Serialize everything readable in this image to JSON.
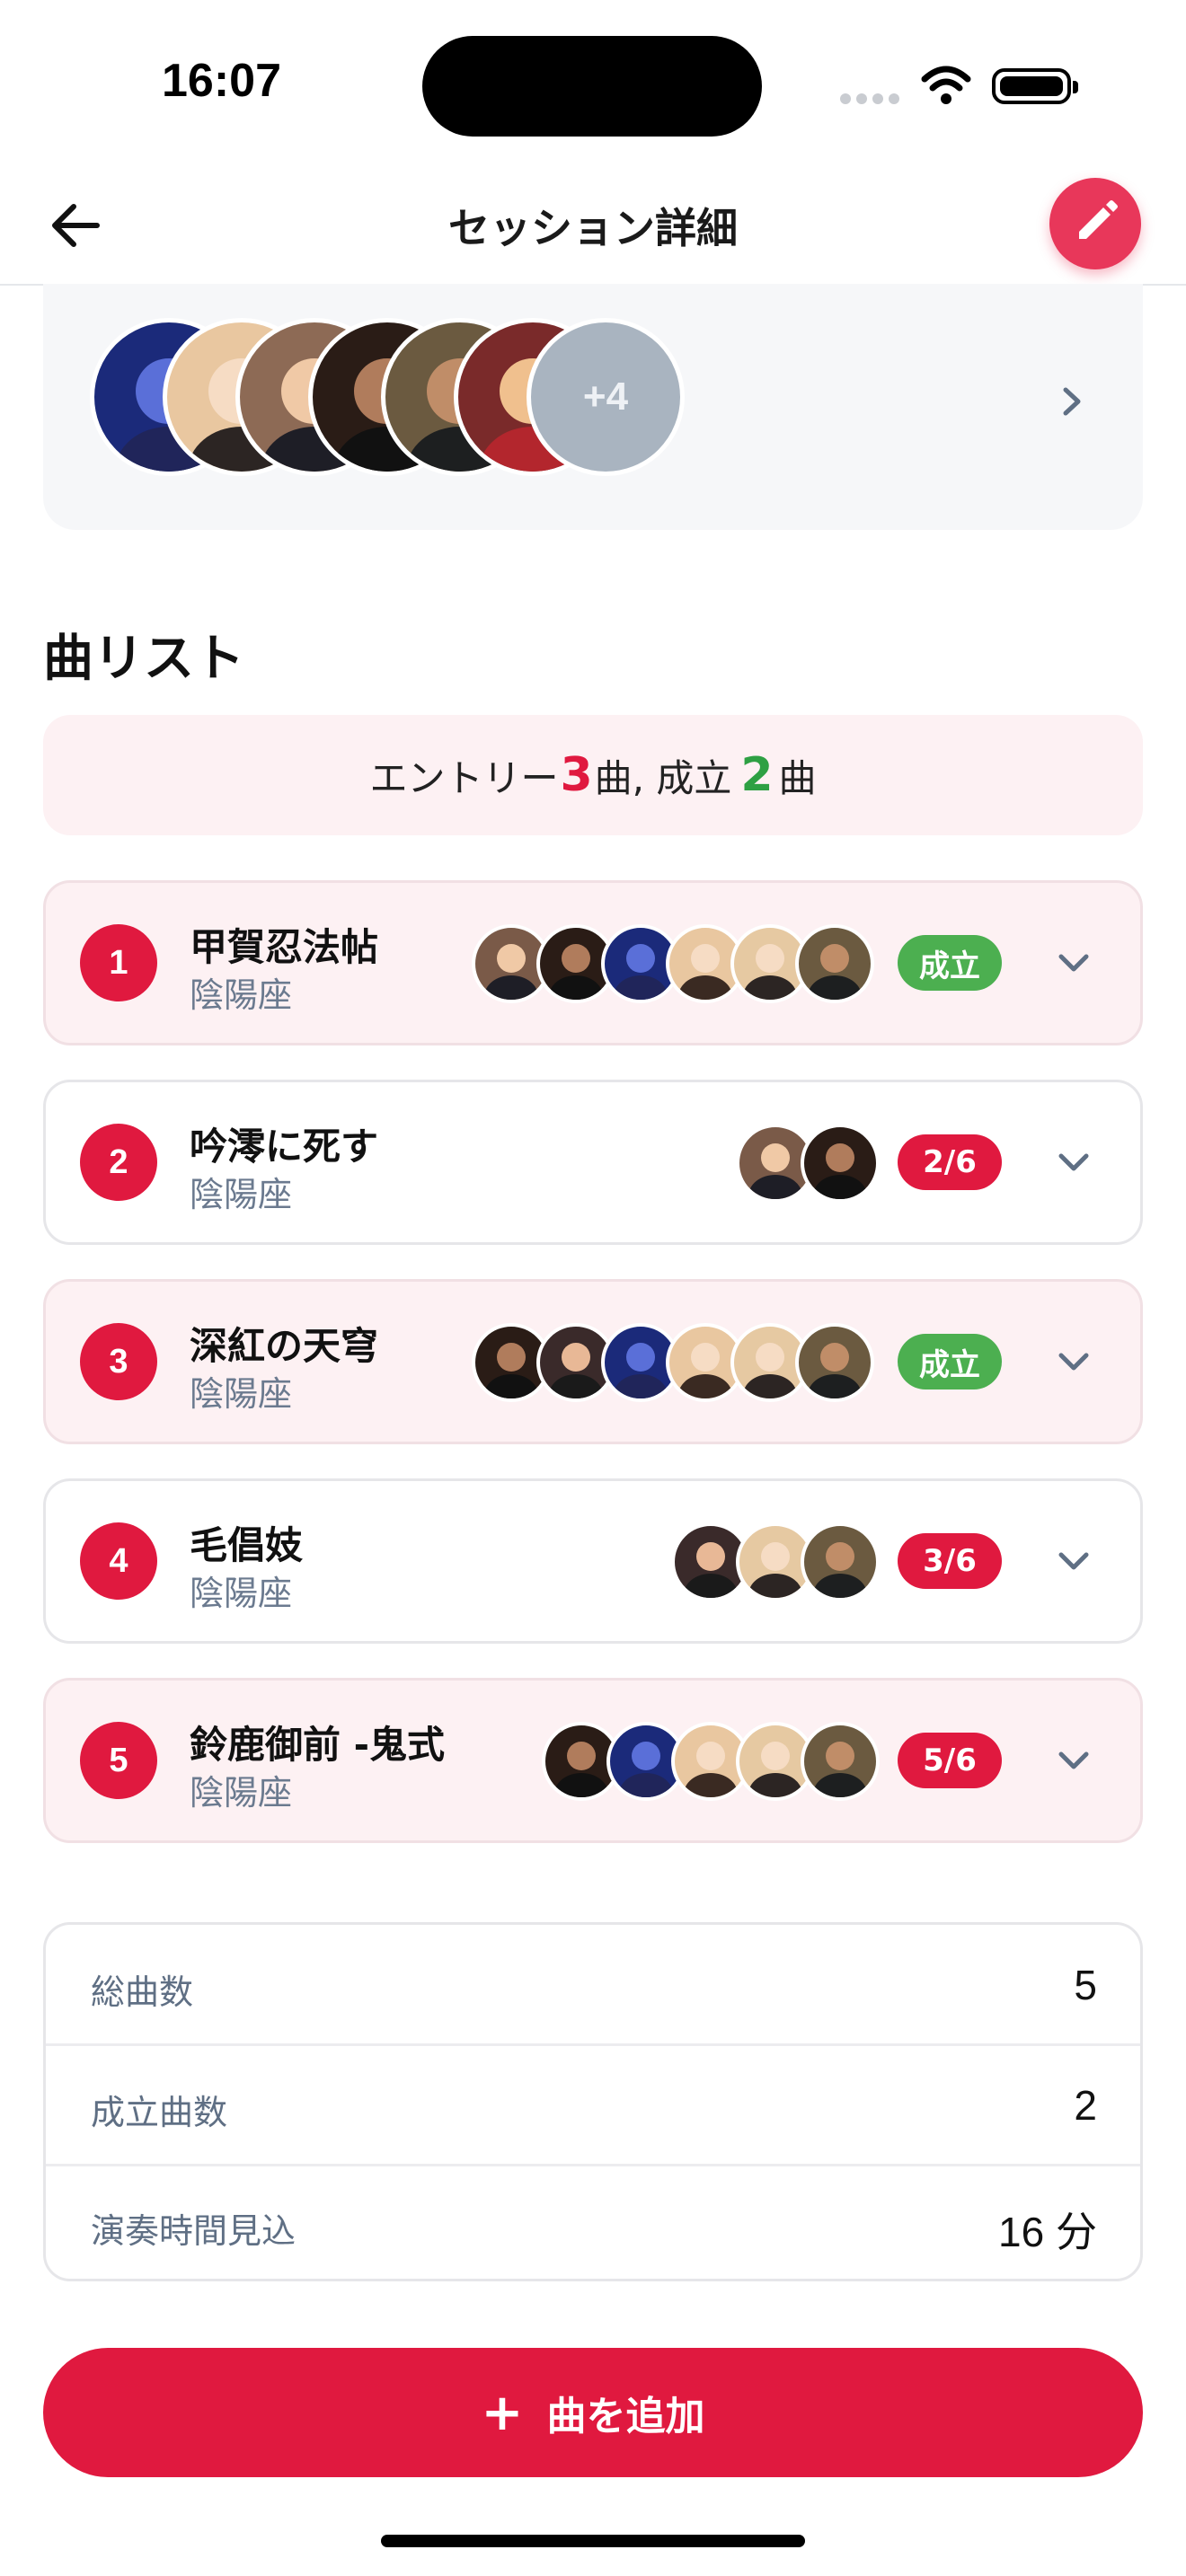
{
  "status_bar": {
    "time": "16:07"
  },
  "header": {
    "title": "セッション詳細"
  },
  "members": {
    "more_label": "+4"
  },
  "song_list": {
    "section_title": "曲リスト",
    "summary": {
      "prefix": "エントリー",
      "entry_count": "3",
      "mid": "曲, 成立",
      "established_count": "2",
      "suffix": "曲"
    },
    "songs": [
      {
        "index": "1",
        "title": "甲賀忍法帖",
        "artist": "陰陽座",
        "status": "成立",
        "status_kind": "ok"
      },
      {
        "index": "2",
        "title": "吟澪に死す",
        "artist": "陰陽座",
        "status": "2/6",
        "status_kind": "progress"
      },
      {
        "index": "3",
        "title": "深紅の天穹",
        "artist": "陰陽座",
        "status": "成立",
        "status_kind": "ok"
      },
      {
        "index": "4",
        "title": "毛倡妓",
        "artist": "陰陽座",
        "status": "3/6",
        "status_kind": "progress"
      },
      {
        "index": "5",
        "title": "鈴鹿御前 -鬼式",
        "artist": "陰陽座",
        "status": "5/6",
        "status_kind": "progress"
      }
    ]
  },
  "stats": [
    {
      "label": "総曲数",
      "value": "5"
    },
    {
      "label": "成立曲数",
      "value": "2"
    },
    {
      "label": "演奏時間見込",
      "value": "16 分"
    }
  ],
  "add_button": {
    "label": "曲を追加"
  },
  "colors": {
    "accent": "#e0193f",
    "ok": "#4caf50",
    "edit": "#e8375a"
  }
}
